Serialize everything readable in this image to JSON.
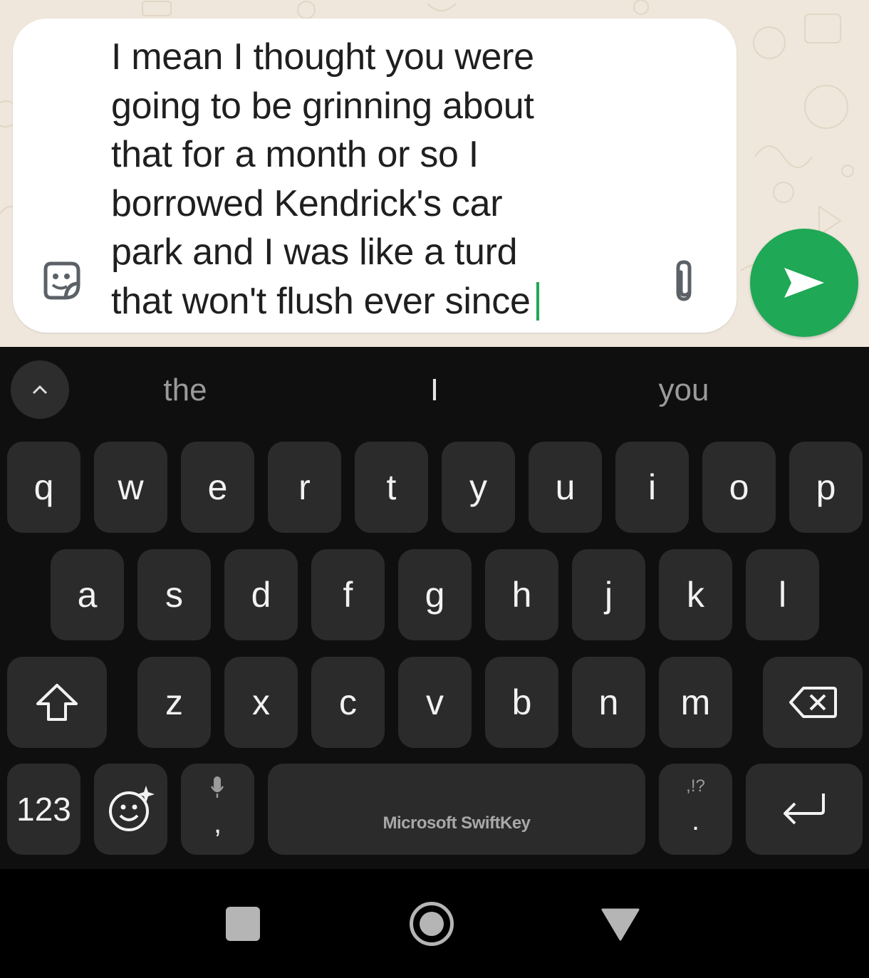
{
  "chat": {
    "message_text": "I mean I thought you were\ngoing to be grinning about\nthat for a month or so I\nborrowed Kendrick's car\npark and I was like a turd\nthat won't flush ever since",
    "sticker_icon": "sticker-icon",
    "attach_icon": "paperclip-icon",
    "send_icon": "send-arrow-icon"
  },
  "keyboard": {
    "suggestions": [
      "the",
      "I",
      "you"
    ],
    "row1": [
      "q",
      "w",
      "e",
      "r",
      "t",
      "y",
      "u",
      "i",
      "o",
      "p"
    ],
    "row2": [
      "a",
      "s",
      "d",
      "f",
      "g",
      "h",
      "j",
      "k",
      "l"
    ],
    "row3": [
      "z",
      "x",
      "c",
      "v",
      "b",
      "n",
      "m"
    ],
    "numbers_label": "123",
    "comma_label": ",",
    "period_label": ".",
    "punct_hint": ",!?",
    "space_label": "Microsoft SwiftKey"
  },
  "colors": {
    "accent": "#1fa855",
    "key_bg": "#2b2b2b",
    "keyboard_bg": "#0f0f0f",
    "chat_bg": "#efe7dc"
  }
}
